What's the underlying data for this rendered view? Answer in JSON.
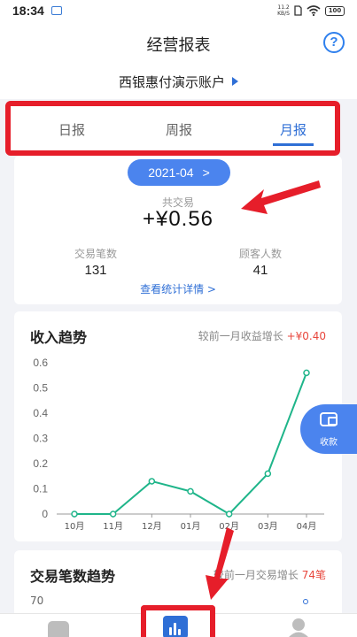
{
  "status_bar": {
    "time": "18:34",
    "network_speed_value": "11.2",
    "network_speed_unit": "KB/S",
    "battery": "100"
  },
  "header": {
    "title": "经营报表",
    "help_icon": "question-circle-icon"
  },
  "account": {
    "name": "西银惠付演示账户",
    "indicator_icon": "triangle-right-icon"
  },
  "tabs": [
    {
      "label": "日报",
      "active": false
    },
    {
      "label": "周报",
      "active": false
    },
    {
      "label": "月报",
      "active": true
    }
  ],
  "summary": {
    "month": "2021-04",
    "month_chevron": ">",
    "total_label": "共交易",
    "total_value": "+¥0.56",
    "transactions_label": "交易笔数",
    "transactions_value": "131",
    "customers_label": "顾客人数",
    "customers_value": "41",
    "detail_link": "查看统计详情 >"
  },
  "income_trend": {
    "title": "收入趋势",
    "compare_label": "较前一月收益增长",
    "compare_value": "+¥0.40"
  },
  "float_button": {
    "icon": "wallet-icon",
    "label": "收款"
  },
  "count_trend": {
    "title": "交易笔数趋势",
    "compare_label": "较前一月交易增长",
    "compare_value": "74笔",
    "first_tick": "70"
  },
  "bottom_nav": [
    {
      "icon": "home-icon",
      "active": false
    },
    {
      "icon": "report-chart-icon",
      "active": true
    },
    {
      "icon": "user-icon",
      "active": false
    }
  ],
  "colors": {
    "accent": "#2f6fd6",
    "pill": "#4b84ee",
    "line": "#1fb58a",
    "annotation_red": "#e61e2a",
    "increase_red": "#e8463c"
  },
  "chart_data": {
    "type": "line",
    "categories": [
      "10月",
      "11月",
      "12月",
      "01月",
      "02月",
      "03月",
      "04月"
    ],
    "series": [
      {
        "values": [
          0,
          0,
          0.13,
          0.09,
          0,
          0.16,
          0.56
        ]
      }
    ],
    "yticks": [
      "0",
      "0.1",
      "0.2",
      "0.3",
      "0.4",
      "0.5",
      "0.6"
    ],
    "ylim": [
      0,
      0.6
    ],
    "title": "收入趋势",
    "grid": false,
    "color": "#1fb58a"
  }
}
